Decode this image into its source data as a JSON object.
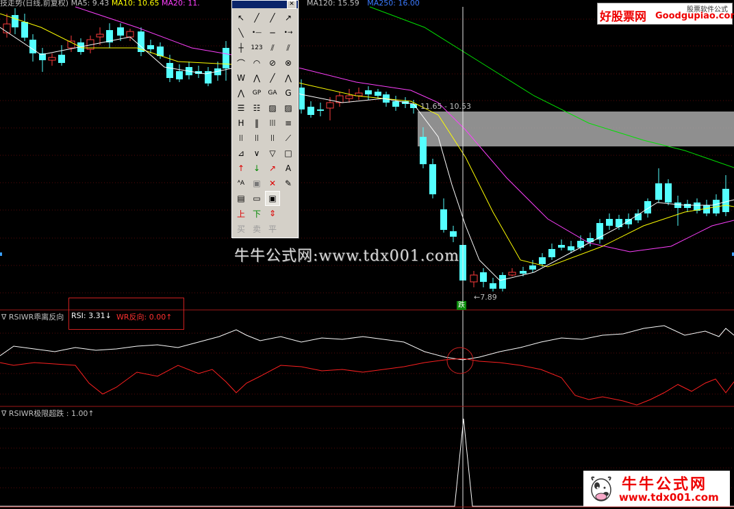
{
  "main_header": {
    "title_frag": "技走势(日线,前复权)",
    "ma5": "MA5: 9.43",
    "ma10": "MA10: 10.65",
    "ma20": "MA20: 11.",
    "ma120": "MA120: 15.59",
    "ma250": "MA250: 16.00"
  },
  "annotations": {
    "range_label": "11.65 - 10.53",
    "low_label": "←7.89",
    "signal": "跌"
  },
  "watermark": "牛牛公式网:www.tdx001.com",
  "logo_top": {
    "name": "好股票网",
    "url": "Goodgupiao.com",
    "tag": "股票软件公式"
  },
  "logo_bottom": {
    "name": "牛牛公式网",
    "url": "www.tdx001.com"
  },
  "panel1": {
    "title": "∇ RSIWR乖离反向",
    "rsi": "RSI: 3.31↓",
    "wr": "WR反向: 0.00↑"
  },
  "panel2": {
    "title": "∇ RSIWR极限超跌 : 1.00↑"
  },
  "toolbox_icons": [
    "cursor-icon",
    "line-icon",
    "ray-icon",
    "arrow-line-icon",
    "segment-icon",
    "h-segment-icon",
    "h-line-icon",
    "h-ray-icon",
    "v-line-icon",
    "price-123-icon",
    "parallel-icon",
    "channel-icon",
    "arc-line-icon",
    "arc-icon",
    "circle-icon",
    "ellipse-icon",
    "wave-icon",
    "zigzag-icon",
    "trend-icon",
    "w-pattern-icon",
    "m-pattern-icon",
    "gp-icon",
    "ga-icon",
    "g-icon",
    "fib-icon",
    "fib-retrace-icon",
    "gann-icon",
    "gann-fan-icon",
    "cycle-icon",
    "time-cycle-icon",
    "fib-time-icon",
    "box-icon",
    "bars-icon",
    "bars2-icon",
    "bars3-icon",
    "speed-line-icon",
    "fan-icon",
    "arrow-down-icon",
    "triangle-icon",
    "rect-icon",
    "up-arrow-icon",
    "down-arrow-icon",
    "red-arrow-icon",
    "text-icon",
    "text-a-icon",
    "stamp-icon",
    "delete-icon",
    "brush-icon",
    "note-icon",
    "ruler-icon",
    "screen-icon",
    "blank-icon",
    "up-label-icon",
    "down-label-icon",
    "updown-icon",
    "blank2-icon",
    "buy-icon",
    "sell-icon",
    "flat-icon",
    "blank3-icon"
  ],
  "toolbox_text": {
    "buy": "买",
    "sell": "卖",
    "flat": "平",
    "up": "上",
    "down": "下"
  },
  "colors": {
    "ma5": "#ffffff",
    "ma10": "#ffff00",
    "ma20": "#ff40ff",
    "ma120": "#00e000",
    "up": "#ff3b3b",
    "down": "#54ffff",
    "rsi": "#ffffff",
    "wr": "#ff2020",
    "divider": "#a01818"
  }
}
